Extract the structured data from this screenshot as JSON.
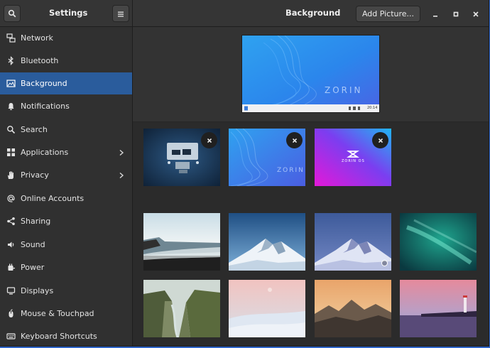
{
  "header": {
    "sidebar_title": "Settings",
    "page_title": "Background",
    "add_picture_label": "Add Picture..."
  },
  "sidebar": {
    "items": [
      {
        "label": "Network",
        "icon": "network-icon"
      },
      {
        "label": "Bluetooth",
        "icon": "bluetooth-icon"
      },
      {
        "label": "Background",
        "icon": "background-icon",
        "active": true
      },
      {
        "label": "Notifications",
        "icon": "bell-icon"
      },
      {
        "label": "Search",
        "icon": "search-icon"
      },
      {
        "label": "Applications",
        "icon": "apps-icon",
        "has_submenu": true
      },
      {
        "label": "Privacy",
        "icon": "hand-icon",
        "has_submenu": true
      },
      {
        "label": "Online Accounts",
        "icon": "at-icon"
      },
      {
        "label": "Sharing",
        "icon": "share-icon"
      },
      {
        "label": "Sound",
        "icon": "speaker-icon"
      },
      {
        "label": "Power",
        "icon": "power-icon"
      },
      {
        "label": "Displays",
        "icon": "display-icon"
      },
      {
        "label": "Mouse & Touchpad",
        "icon": "mouse-icon"
      },
      {
        "label": "Keyboard Shortcuts",
        "icon": "keyboard-icon"
      }
    ]
  },
  "preview": {
    "wallpaper_text": "ZORIN",
    "clock": "20:14"
  },
  "custom_wallpapers": [
    {
      "name": "desk-setup"
    },
    {
      "name": "zorin-blue-waves",
      "text": "ZORIN"
    },
    {
      "name": "zorin-os-gradient",
      "text": "ZORIN OS"
    }
  ],
  "colors": {
    "accent": "#2a5c9c",
    "window_bg": "#2b2b2b",
    "desktop_bg": "#2f66c9"
  }
}
